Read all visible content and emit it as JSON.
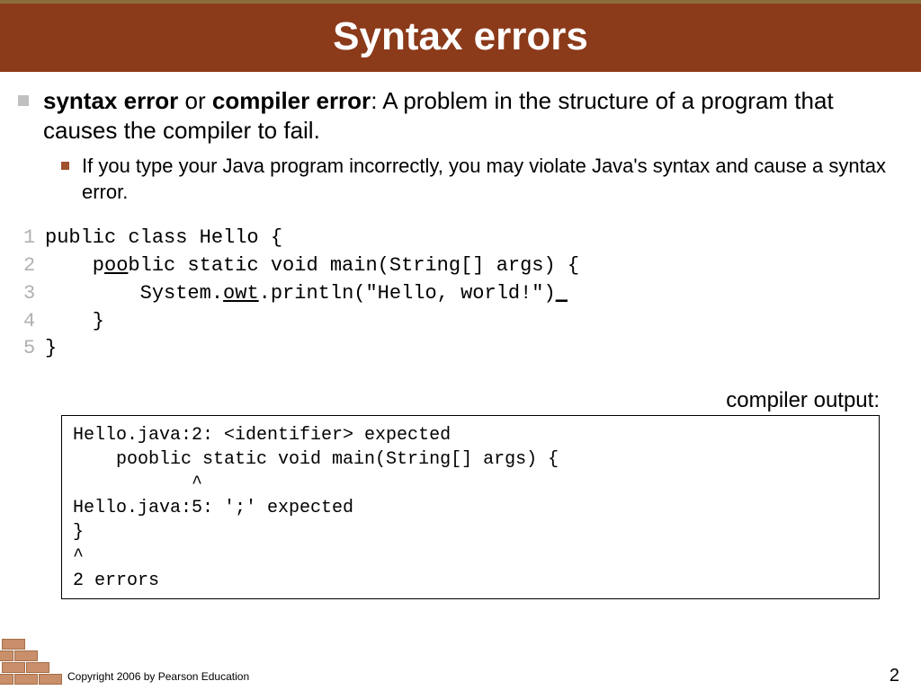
{
  "header": {
    "title": "Syntax errors"
  },
  "bullets": {
    "l1": {
      "b1": "syntax error",
      "mid": " or ",
      "b2": "compiler error",
      "rest": ": A problem in the structure of a program that causes the compiler to fail."
    },
    "l2": "If you type your Java program incorrectly, you may violate Java's syntax and cause a syntax error."
  },
  "code": {
    "ln1": "1",
    "c1a": "public class Hello {",
    "ln2": "2",
    "c2a": "    p",
    "c2u": "oo",
    "c2b": "blic static void main(String[] args) {",
    "ln3": "3",
    "c3a": "        System.",
    "c3u": "owt",
    "c3b": ".println(\"Hello, world!\")",
    "c3c": "_",
    "ln4": "4",
    "c4a": "    }",
    "ln5": "5",
    "c5a": "}"
  },
  "compiler": {
    "label": "compiler output:",
    "text": "Hello.java:2: <identifier> expected\n    pooblic static void main(String[] args) {\n           ^\nHello.java:5: ';' expected\n}\n^\n2 errors"
  },
  "footer": {
    "copyright": "Copyright 2006 by Pearson Education",
    "page": "2"
  }
}
